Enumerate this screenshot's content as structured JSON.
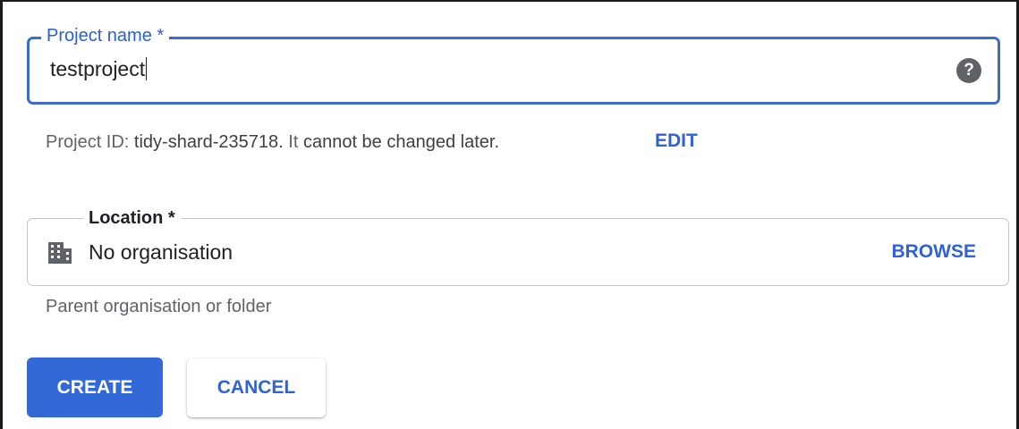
{
  "project_name_field": {
    "label": "Project name *",
    "value": "testproject",
    "help_icon": "help-circle-icon",
    "accent_color": "#3c6bd6"
  },
  "project_id_line": {
    "prefix": "Project ID:",
    "id": "tidy-shard-235718.",
    "middle": "It",
    "suffix": "cannot be changed later.",
    "edit_label": "EDIT"
  },
  "location_field": {
    "label": "Location *",
    "icon": "building-icon",
    "value": "No organisation",
    "browse_label": "BROWSE",
    "helper_text": "Parent organisation or folder"
  },
  "actions": {
    "create_label": "CREATE",
    "cancel_label": "CANCEL",
    "primary_color": "#3369d6",
    "link_color": "#2f62d6"
  }
}
